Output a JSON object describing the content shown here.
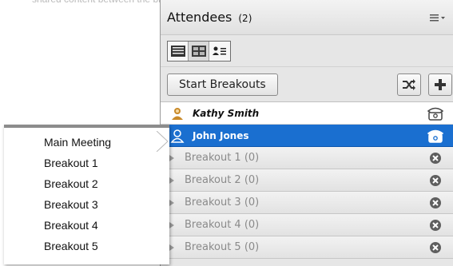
{
  "top_faded_text": "shared content between the breakout",
  "panel": {
    "title": "Attendees",
    "count": "(2)",
    "menu_icon": "hamburger-dropdown-icon"
  },
  "view_modes": [
    "list-view-icon",
    "grid-view-icon",
    "attendee-list-icon"
  ],
  "actions": {
    "start_breakouts": "Start Breakouts",
    "shuffle_icon": "shuffle-icon",
    "add_icon": "plus-icon"
  },
  "attendees": [
    {
      "name": "Kathy Smith",
      "icon": "host-user-icon",
      "phone_icon": "phone-icon"
    },
    {
      "name": "John Jones",
      "icon": "user-icon",
      "phone_icon": "phone-icon",
      "selected": true
    }
  ],
  "breakout_rooms": [
    {
      "label": "Breakout 1 (0)"
    },
    {
      "label": "Breakout 2 (0)"
    },
    {
      "label": "Breakout 3 (0)"
    },
    {
      "label": "Breakout 4 (0)"
    },
    {
      "label": "Breakout 5 (0)"
    }
  ],
  "move_menu": {
    "items": [
      "Main Meeting",
      "Breakout 1",
      "Breakout 2",
      "Breakout 3",
      "Breakout 4",
      "Breakout 5"
    ]
  },
  "colors": {
    "selection_blue": "#1a6fd0",
    "panel_bg": "#e6e6e6"
  }
}
